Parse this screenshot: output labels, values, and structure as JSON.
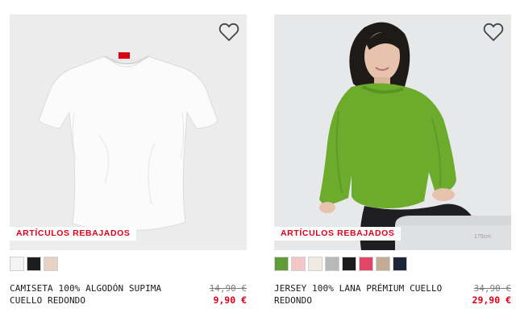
{
  "products": [
    {
      "name": "CAMISETA 100% ALGODÓN SUPIMA CUELLO REDONDO",
      "sale_label": "ARTÍCULOS REBAJADOS",
      "old_price": "14,90 €",
      "new_price": "9,90 €",
      "favorite_icon": "heart-outline-icon",
      "image_subject": "white-tshirt",
      "swatches": [
        {
          "color": "#f3f3f3",
          "name": "white"
        },
        {
          "color": "#1d1d1d",
          "name": "black"
        },
        {
          "color": "#e6d3c3",
          "name": "beige"
        }
      ]
    },
    {
      "name": "JERSEY 100% LANA PRÉMIUM CUELLO REDONDO",
      "sale_label": "ARTÍCULOS REBAJADOS",
      "old_price": "34,90 €",
      "new_price": "29,90 €",
      "favorite_icon": "heart-outline-icon",
      "image_subject": "green-sweater-model",
      "image_caption": "175cm",
      "swatches": [
        {
          "color": "#5f9c35",
          "name": "green"
        },
        {
          "color": "#f5c6c6",
          "name": "pink"
        },
        {
          "color": "#efebe0",
          "name": "off-white"
        },
        {
          "color": "#b7b9bb",
          "name": "gray"
        },
        {
          "color": "#1b1b1b",
          "name": "black"
        },
        {
          "color": "#e04667",
          "name": "red"
        },
        {
          "color": "#c2ad93",
          "name": "beige"
        },
        {
          "color": "#1c2537",
          "name": "navy"
        }
      ]
    }
  ],
  "colors": {
    "sale_red": "#e0001a",
    "image_bg": "#ececec"
  }
}
